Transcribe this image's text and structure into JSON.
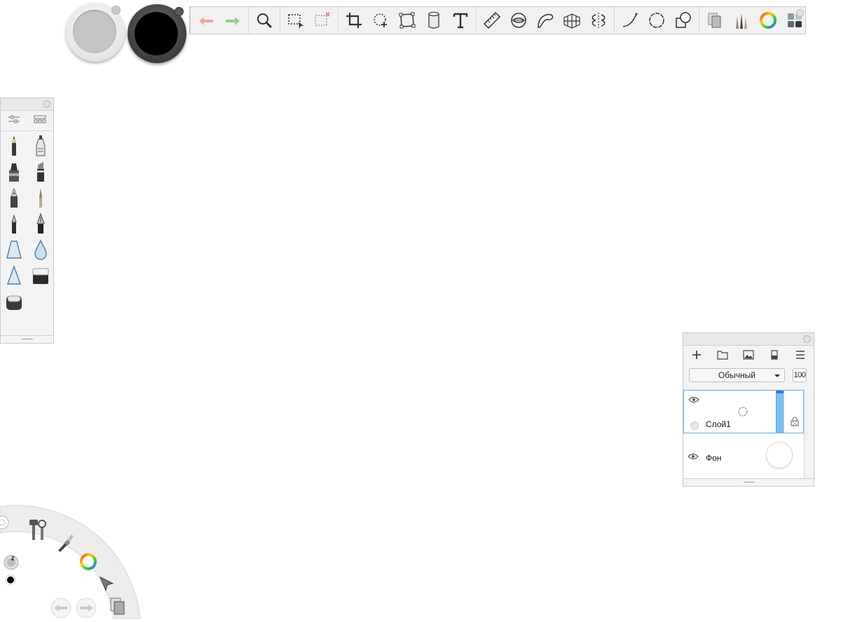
{
  "app": "SketchBook",
  "colors": {
    "canvas": "#ffffff",
    "panel_bg": "#f3f3f3",
    "panel_border": "#c9c9c9",
    "selection_blue": "#7cc0f2",
    "undo_red": "#f0a8a0",
    "redo_green": "#8fd08f",
    "primary_swatch": "#000000",
    "secondary_swatch": "#c4c4c4"
  },
  "color_puck": {
    "primary_color": "#000000",
    "secondary_color": "#c4c4c4"
  },
  "toolbar": {
    "tools": [
      "undo-icon",
      "redo-icon",
      "zoom-icon",
      "select-icon",
      "clear-selection-icon",
      "crop-icon",
      "transform-icon",
      "distort-icon",
      "fill-icon",
      "text-icon",
      "ruler-icon",
      "ellipse-guide-icon",
      "french-curve-icon",
      "perspective-icon",
      "symmetry-icon",
      "line-icon",
      "ellipse-icon",
      "shape-icon",
      "copy-layers-icon",
      "brush-library-icon",
      "color-wheel-icon",
      "palette-grid-icon"
    ]
  },
  "brush_palette": {
    "brushes": [
      "pencil-icon",
      "airbrush-icon",
      "marker-icon",
      "chisel-marker-icon",
      "felt-pen-icon",
      "paintbrush-icon",
      "ballpoint-icon",
      "ink-pen-icon",
      "smudge-icon",
      "blur-icon",
      "sharpen-icon",
      "eraser-hard-icon",
      "eraser-soft-icon"
    ]
  },
  "layers_panel": {
    "blend_mode": "Обычный",
    "opacity": "100",
    "layers": [
      {
        "name": "Слой1",
        "selected": true,
        "visible": true
      },
      {
        "name": "Фон",
        "selected": false,
        "visible": true
      }
    ]
  },
  "lagoon": {
    "brush_size_badge": "2",
    "items": [
      "settings-icon",
      "brush-icon",
      "color-wheel-icon",
      "select-arrow-icon",
      "undo-icon",
      "redo-icon",
      "layers-icon"
    ]
  }
}
